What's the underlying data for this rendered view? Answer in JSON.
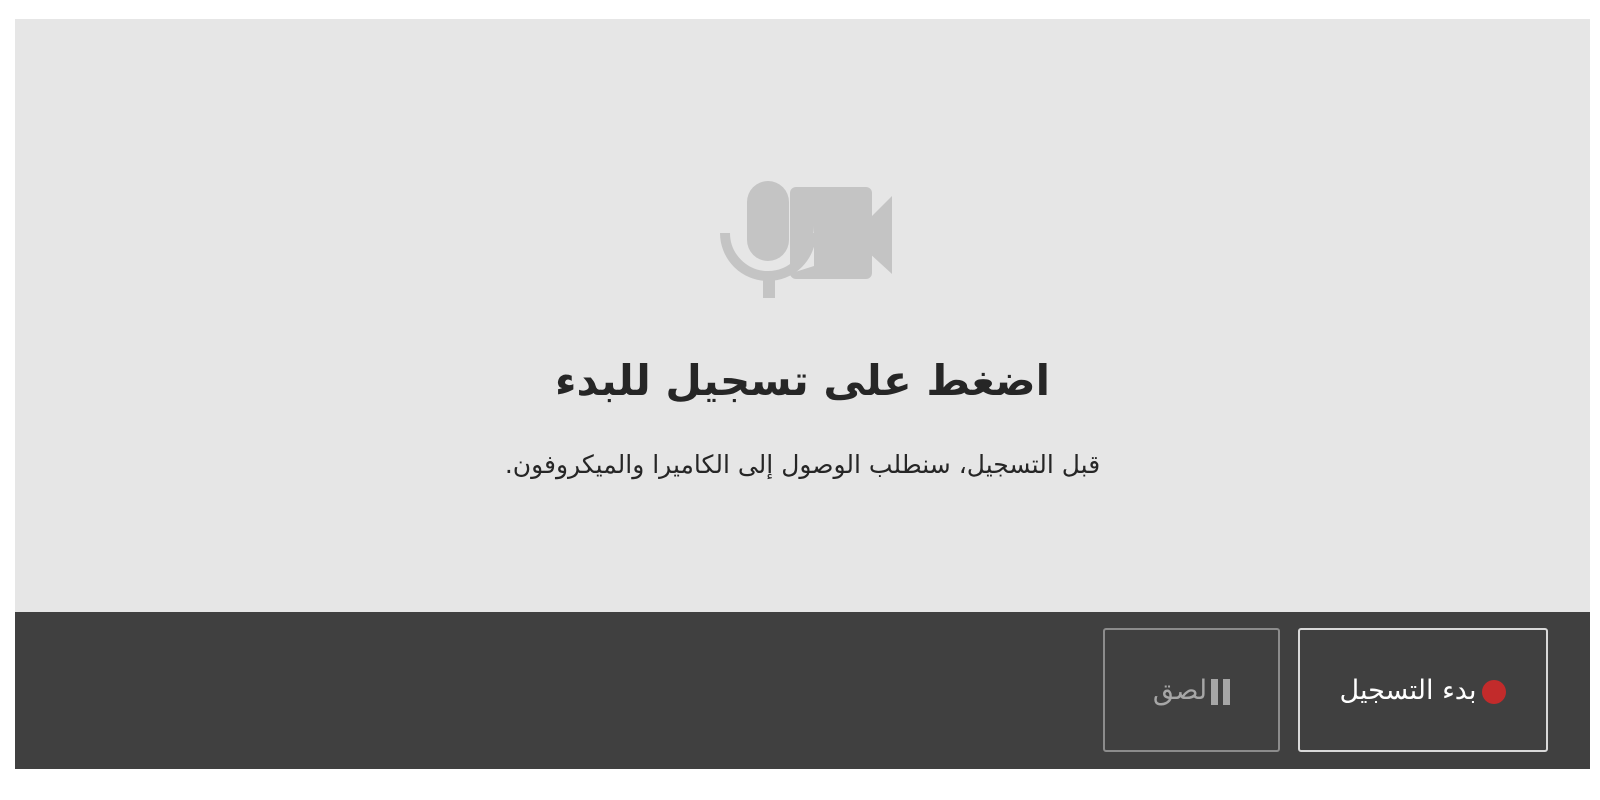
{
  "stage": {
    "icon": "microphone-camera-icon",
    "heading": "اضغط على تسجيل للبدء",
    "subtext": "قبل التسجيل، سنطلب الوصول إلى الكاميرا والميكروفون."
  },
  "controls": {
    "record_label": "بدء التسجيل",
    "record_icon": "record-dot-icon",
    "pause_label": "لصق",
    "pause_icon": "pause-icon"
  },
  "colors": {
    "stage_background": "#e6e6e6",
    "controls_background": "#404040",
    "record_dot": "#c22b2b",
    "icon_gray": "#c4c4c4",
    "disabled_text": "#a6a6a6"
  }
}
